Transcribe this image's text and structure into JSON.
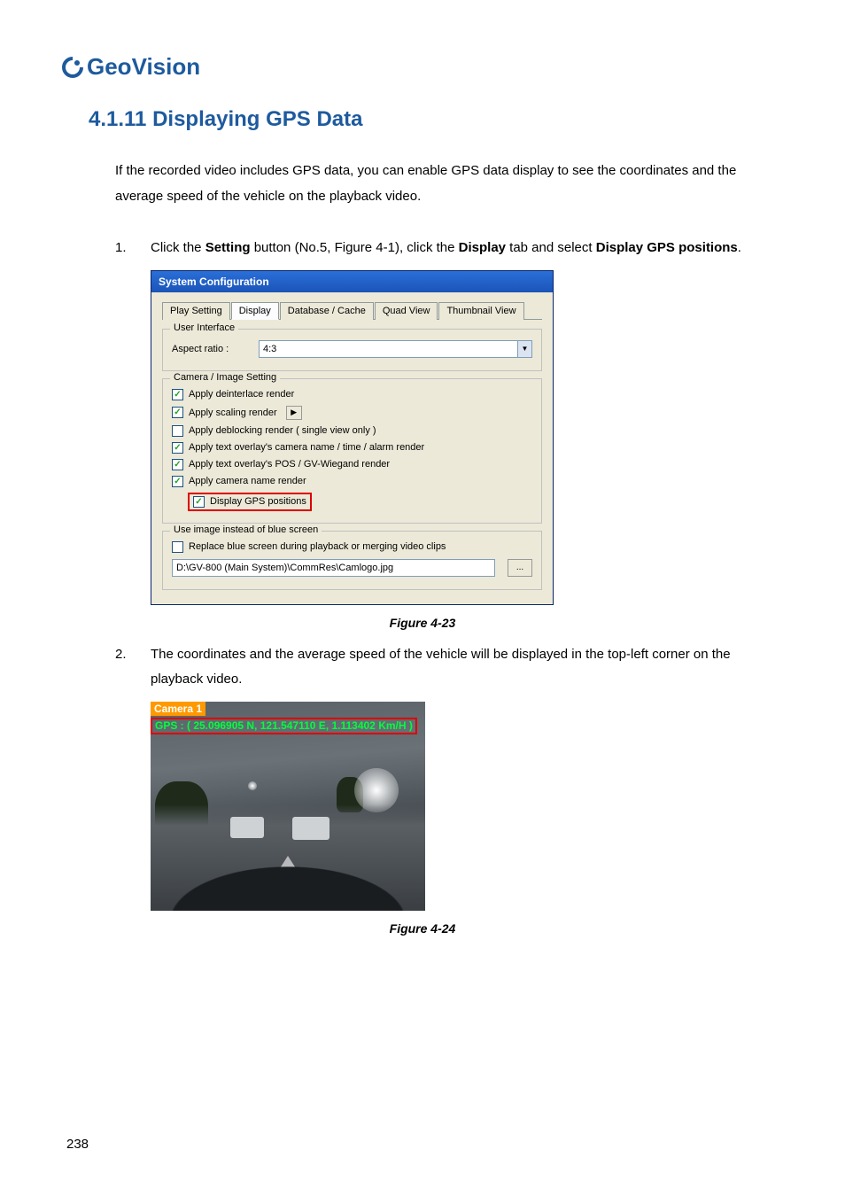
{
  "logo": {
    "text": "GeoVision"
  },
  "heading": "4.1.11  Displaying GPS Data",
  "intro": "If the recorded video includes GPS data, you can enable GPS data display to see the coordinates and the average speed of the vehicle on the playback video.",
  "steps": {
    "num1": "1.",
    "s1_a": "Click the ",
    "s1_b": "Setting",
    "s1_c": " button (No.5, Figure 4-1), click the ",
    "s1_d": "Display",
    "s1_e": " tab and select ",
    "s1_f": "Display GPS positions",
    "s1_g": ".",
    "num2": "2.",
    "s2": "The coordinates and the average speed of the vehicle will be displayed in the top-left corner on the playback video."
  },
  "dialog": {
    "title": "System Configuration",
    "tabs": [
      "Play Setting",
      "Display",
      "Database / Cache",
      "Quad View",
      "Thumbnail View"
    ],
    "group_user_interface": "User Interface",
    "aspect_label": "Aspect ratio :",
    "aspect_value": "4:3",
    "group_camera": "Camera / Image Setting",
    "checks": [
      {
        "checked": true,
        "label": "Apply deinterlace render"
      },
      {
        "checked": true,
        "label": "Apply scaling render",
        "has_btn": true
      },
      {
        "checked": false,
        "label": "Apply deblocking render ( single view only )"
      },
      {
        "checked": true,
        "label": "Apply text overlay's camera name / time / alarm render"
      },
      {
        "checked": true,
        "label": "Apply text overlay's POS / GV-Wiegand render"
      },
      {
        "checked": true,
        "label": "Apply camera name render"
      }
    ],
    "gps_check": {
      "checked": true,
      "label": "Display GPS positions"
    },
    "group_blue": "Use image instead of blue screen",
    "blue_check": {
      "checked": false,
      "label": "Replace blue screen during playback or merging video clips"
    },
    "path": "D:\\GV-800 (Main System)\\CommRes\\Camlogo.jpg",
    "browse": "..."
  },
  "fig1": "Figure 4-23",
  "fig2": "Figure 4-24",
  "camera": {
    "name": "Camera 1",
    "gps": "GPS : ( 25.096905 N, 121.547110 E, 1.113402 Km/H )"
  },
  "page_num": "238"
}
